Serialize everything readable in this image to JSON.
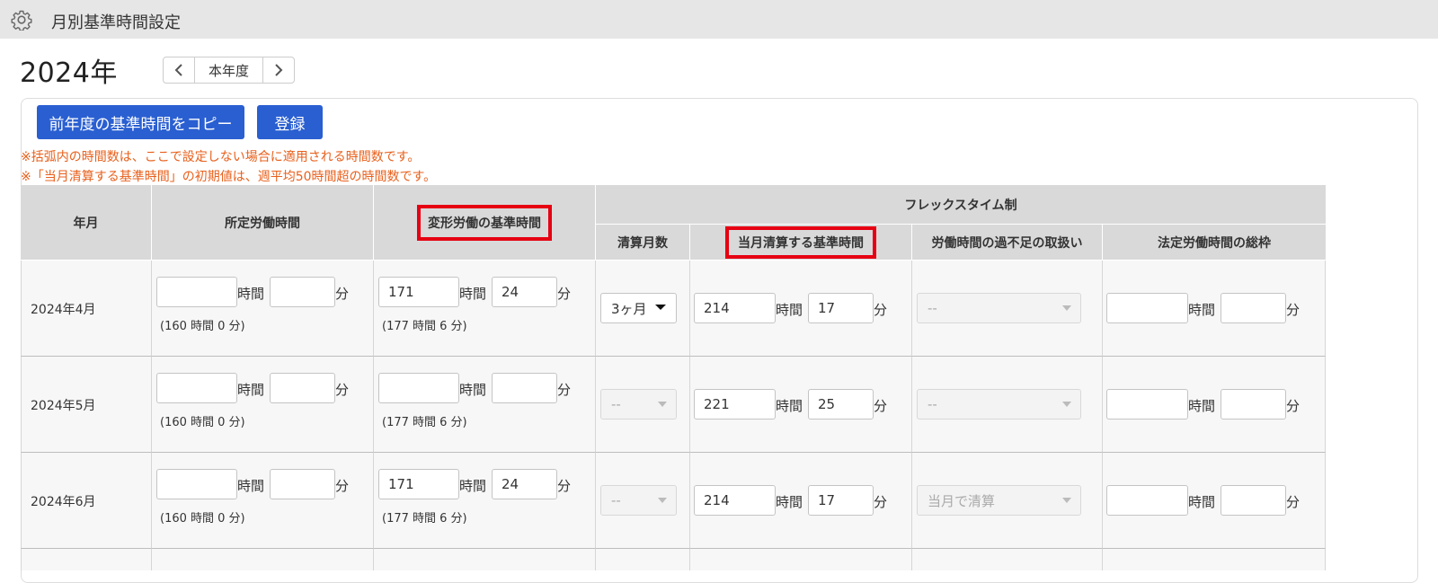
{
  "header": {
    "title": "月別基準時間設定",
    "icon": "gear-icon"
  },
  "year": {
    "label": "2024年",
    "current_label": "本年度"
  },
  "toolbar": {
    "copy_label": "前年度の基準時間をコピー",
    "save_label": "登録"
  },
  "notes": [
    "※括弧内の時間数は、ここで設定しない場合に適用される時間数です。",
    "※「当月清算する基準時間」の初期値は、週平均50時間超の時間数です。"
  ],
  "table": {
    "headers": {
      "month": "年月",
      "scheduled": "所定労働時間",
      "variable": "変形労働の基準時間",
      "flex_group": "フレックスタイム制",
      "settlement_months": "清算月数",
      "monthly_settle": "当月清算する基準時間",
      "shortage": "労働時間の過不足の取扱い",
      "legal_cap": "法定労働時間の総枠"
    },
    "units": {
      "hour": "時間",
      "minute": "分"
    },
    "rows": [
      {
        "month": "2024年4月",
        "scheduled": {
          "hours": "",
          "minutes": "",
          "hint": "(160 時間 0 分)"
        },
        "variable": {
          "hours": "171",
          "minutes": "24",
          "hint": "(177 時間 6 分)"
        },
        "settlement_months": "3ヶ月",
        "monthly_settle": {
          "hours": "214",
          "minutes": "17"
        },
        "shortage": "--",
        "legal_cap": {
          "hours": "",
          "minutes": ""
        }
      },
      {
        "month": "2024年5月",
        "scheduled": {
          "hours": "",
          "minutes": "",
          "hint": "(160 時間 0 分)"
        },
        "variable": {
          "hours": "",
          "minutes": "",
          "hint": "(177 時間 6 分)"
        },
        "settlement_months": "--",
        "monthly_settle": {
          "hours": "221",
          "minutes": "25"
        },
        "shortage": "--",
        "legal_cap": {
          "hours": "",
          "minutes": ""
        }
      },
      {
        "month": "2024年6月",
        "scheduled": {
          "hours": "",
          "minutes": "",
          "hint": "(160 時間 0 分)"
        },
        "variable": {
          "hours": "171",
          "minutes": "24",
          "hint": "(177 時間 6 分)"
        },
        "settlement_months": "--",
        "monthly_settle": {
          "hours": "214",
          "minutes": "17"
        },
        "shortage": "当月で清算",
        "legal_cap": {
          "hours": "",
          "minutes": ""
        }
      }
    ]
  },
  "colors": {
    "accent": "#2a5fd1",
    "note": "#e8601c",
    "highlight": "#e60012",
    "header_bg": "#d9d9d9"
  }
}
